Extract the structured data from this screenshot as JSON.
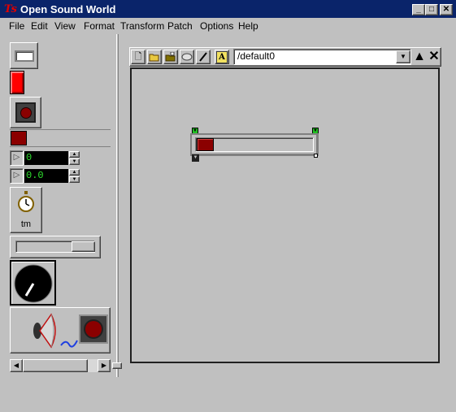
{
  "window": {
    "title": "Open Sound World",
    "app_icon": "Ts"
  },
  "menu": [
    "File",
    "Edit",
    "View",
    "Format",
    "Transform",
    "Patch",
    "Options",
    "Help"
  ],
  "palette": {
    "int_box_value": "0",
    "float_box_value": "0.0",
    "timer_label": "tm"
  },
  "patch": {
    "path": "/default0"
  },
  "colors": {
    "title_bar": "#0a246a",
    "led_red": "#ff0000",
    "slider_knob": "#8b0000",
    "number_text": "#2ee02e",
    "inlet": "#22c022"
  },
  "icons": [
    "minimize-icon",
    "maximize-icon",
    "close-icon",
    "new-file-icon",
    "open-folder-icon",
    "save-icon",
    "piggy-icon",
    "pencil-icon",
    "text-tool-icon",
    "dropdown-arrow-icon",
    "up-arrow-icon",
    "close-x-icon",
    "timer-icon",
    "speaker-icon"
  ]
}
